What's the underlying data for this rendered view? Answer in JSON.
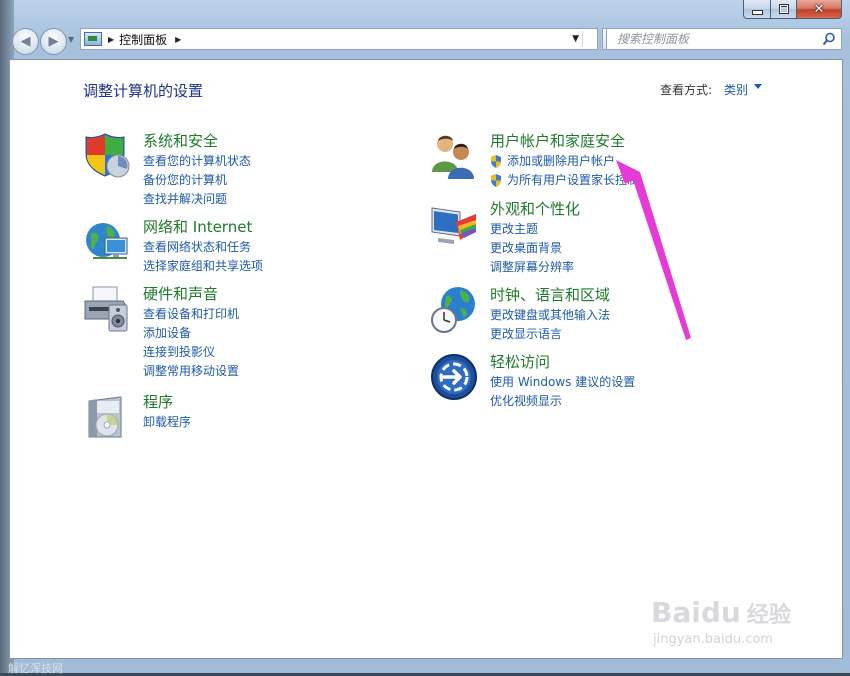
{
  "window": {
    "caption_buttons": [
      "minimize",
      "maximize",
      "close"
    ]
  },
  "nav": {
    "breadcrumb": "控制面板",
    "search_placeholder": "搜索控制面板"
  },
  "content": {
    "heading": "调整计算机的设置",
    "view_by_label": "查看方式:",
    "view_by_value": "类别"
  },
  "categories": [
    {
      "title": "系统和安全",
      "icon": "shield-icon",
      "links": [
        "查看您的计算机状态",
        "备份您的计算机",
        "查找并解决问题"
      ]
    },
    {
      "title": "网络和 Internet",
      "icon": "network-globe-icon",
      "links": [
        "查看网络状态和任务",
        "选择家庭组和共享选项"
      ]
    },
    {
      "title": "硬件和声音",
      "icon": "printer-icon",
      "links": [
        "查看设备和打印机",
        "添加设备",
        "连接到投影仪",
        "调整常用移动设置"
      ]
    },
    {
      "title": "程序",
      "icon": "programs-disc-icon",
      "links": [
        "卸载程序"
      ]
    },
    {
      "title": "用户帐户和家庭安全",
      "icon": "users-icon",
      "links": [
        "添加或删除用户帐户",
        "为所有用户设置家长控制"
      ]
    },
    {
      "title": "外观和个性化",
      "icon": "appearance-monitor-icon",
      "links": [
        "更改主题",
        "更改桌面背景",
        "调整屏幕分辨率"
      ]
    },
    {
      "title": "时钟、语言和区域",
      "icon": "clock-globe-icon",
      "links": [
        "更改键盘或其他输入法",
        "更改显示语言"
      ]
    },
    {
      "title": "轻松访问",
      "icon": "ease-of-access-icon",
      "links": [
        "使用 Windows 建议的设置",
        "优化视频显示"
      ]
    }
  ],
  "annotation": {
    "color": "#e63ad6"
  },
  "watermark": {
    "logo": "Baidu",
    "brand": "经验",
    "url": "jingyan.baidu.com"
  },
  "footer_fragment": "解忆浑技网"
}
